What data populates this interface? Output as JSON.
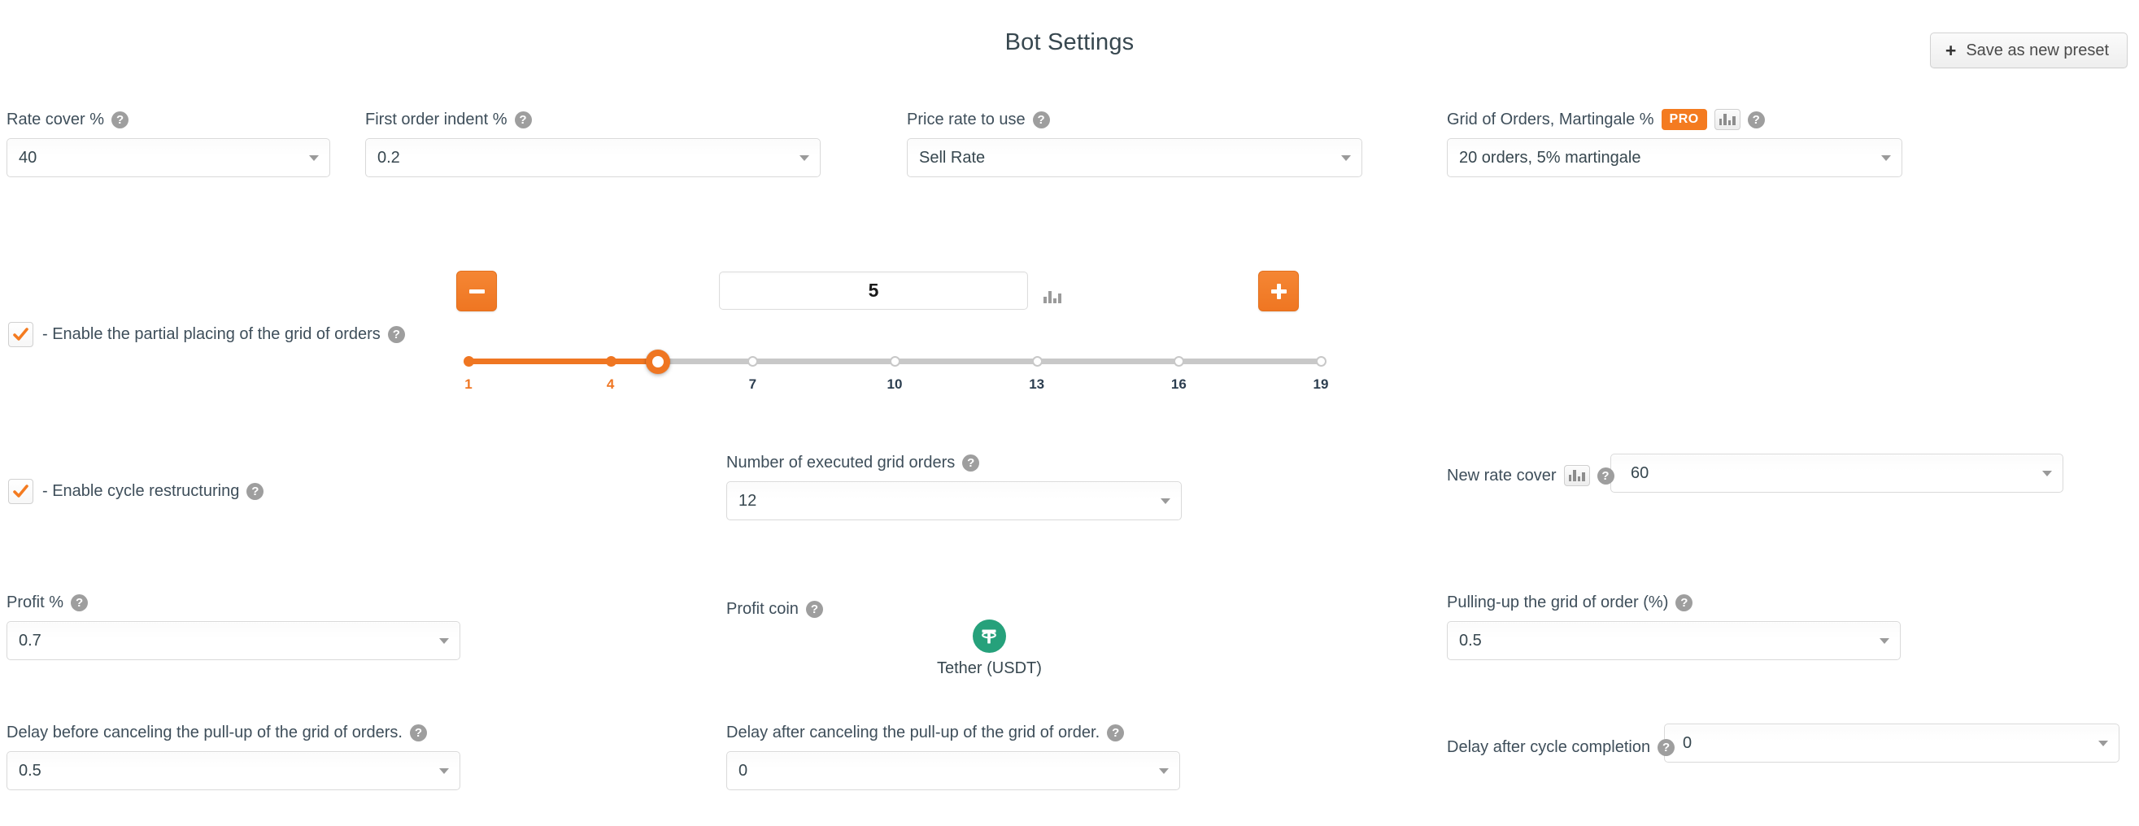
{
  "header": {
    "title": "Bot Settings",
    "save_preset_label": "Save as new preset",
    "plus_glyph": "+"
  },
  "icons": {
    "help": "?",
    "help_icon_name": "help-icon",
    "chart_icon_name": "bar-chart-icon",
    "plus_icon_name": "plus-icon"
  },
  "row1": {
    "rate_cover": {
      "label": "Rate cover %",
      "value": "40"
    },
    "first_order_indent": {
      "label": "First order indent %",
      "value": "0.2"
    },
    "price_rate": {
      "label": "Price rate to use",
      "value": "Sell Rate"
    },
    "grid_orders": {
      "label": "Grid of Orders, Martingale %",
      "badge": "PRO",
      "value": "20 orders, 5% martingale"
    }
  },
  "partial_placing": {
    "checkbox_checked": true,
    "label": "- Enable the partial placing of the grid of orders",
    "minus_label": "-",
    "plus_label": "+",
    "value": "5"
  },
  "slider": {
    "min": 1,
    "max": 19,
    "value": 5,
    "ticks": [
      {
        "label": "1",
        "value": 1,
        "active": true
      },
      {
        "label": "4",
        "value": 4,
        "active": true
      },
      {
        "label": "7",
        "value": 7,
        "active": false
      },
      {
        "label": "10",
        "value": 10,
        "active": false
      },
      {
        "label": "13",
        "value": 13,
        "active": false
      },
      {
        "label": "16",
        "value": 16,
        "active": false
      },
      {
        "label": "19",
        "value": 19,
        "active": false
      }
    ]
  },
  "cycle_restructuring": {
    "checkbox_checked": true,
    "label": "- Enable cycle restructuring"
  },
  "executed_orders": {
    "label": "Number of executed grid orders",
    "value": "12"
  },
  "new_rate_cover": {
    "label": "New rate cover",
    "value": "60"
  },
  "profit": {
    "label": "Profit %",
    "value": "0.7"
  },
  "profit_coin": {
    "label": "Profit coin",
    "coin_name": "Tether (USDT)",
    "coin_symbol": "T",
    "coin_color": "#26a17b"
  },
  "pulling_up": {
    "label": "Pulling-up the grid of order (%)",
    "value": "0.5"
  },
  "delay_before_cancel": {
    "label": "Delay before canceling the pull-up of the grid of orders.",
    "value": "0.5"
  },
  "delay_after_cancel": {
    "label": "Delay after canceling the pull-up of the grid of order.",
    "value": "0"
  },
  "delay_after_cycle": {
    "label": "Delay after cycle completion",
    "value": "0"
  },
  "colors": {
    "accent": "#ef7622",
    "pro_badge": "#f47b20",
    "text": "#37474f",
    "tether_green": "#26a17b"
  }
}
